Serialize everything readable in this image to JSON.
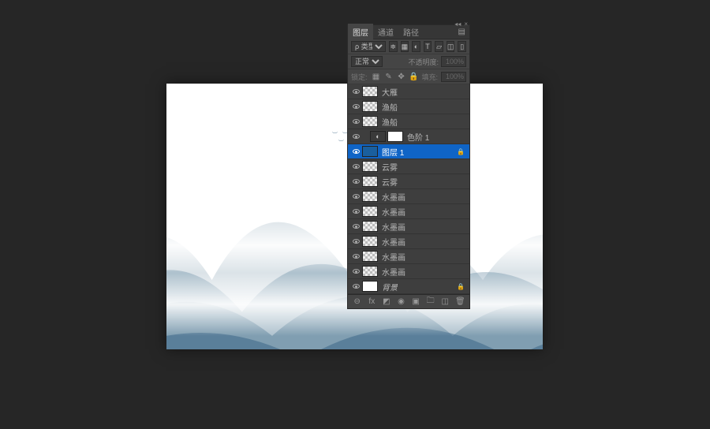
{
  "tabs": {
    "layers": "图层",
    "channels": "通道",
    "paths": "路径"
  },
  "filter": {
    "kind_label": "ρ 类型",
    "kind_value": "≑"
  },
  "blend": {
    "mode": "正常",
    "opacity_label": "不透明度:",
    "opacity_value": "100%"
  },
  "lock": {
    "label": "锁定:",
    "fill_label": "填充:",
    "fill_value": "100%"
  },
  "layers": [
    {
      "name": "大雁",
      "thumb": "checker",
      "indent": 0
    },
    {
      "name": "渔船",
      "thumb": "checker",
      "indent": 0
    },
    {
      "name": "渔船",
      "thumb": "checker",
      "indent": 0
    },
    {
      "name": "色阶 1",
      "thumb": "adj",
      "indent": 1,
      "adj_glyph": "◐"
    },
    {
      "name": "图层 1",
      "thumb": "solid-blue",
      "indent": 0,
      "selected": true,
      "locked": true
    },
    {
      "name": "云雾",
      "thumb": "checker",
      "indent": 0
    },
    {
      "name": "云雾",
      "thumb": "checker",
      "indent": 0
    },
    {
      "name": "水墨画",
      "thumb": "checker",
      "indent": 0
    },
    {
      "name": "水墨画",
      "thumb": "checker",
      "indent": 0
    },
    {
      "name": "水墨画",
      "thumb": "checker",
      "indent": 0
    },
    {
      "name": "水墨画",
      "thumb": "checker",
      "indent": 0
    },
    {
      "name": "水墨画",
      "thumb": "checker",
      "indent": 0
    },
    {
      "name": "水墨画",
      "thumb": "checker",
      "indent": 0
    },
    {
      "name": "背景",
      "thumb": "white",
      "indent": 0,
      "locked": true,
      "italic": true
    }
  ],
  "footer_icons": [
    "⊖",
    "fx",
    "◩",
    "◉",
    "▣",
    "🗀",
    "◫",
    "🗑"
  ]
}
